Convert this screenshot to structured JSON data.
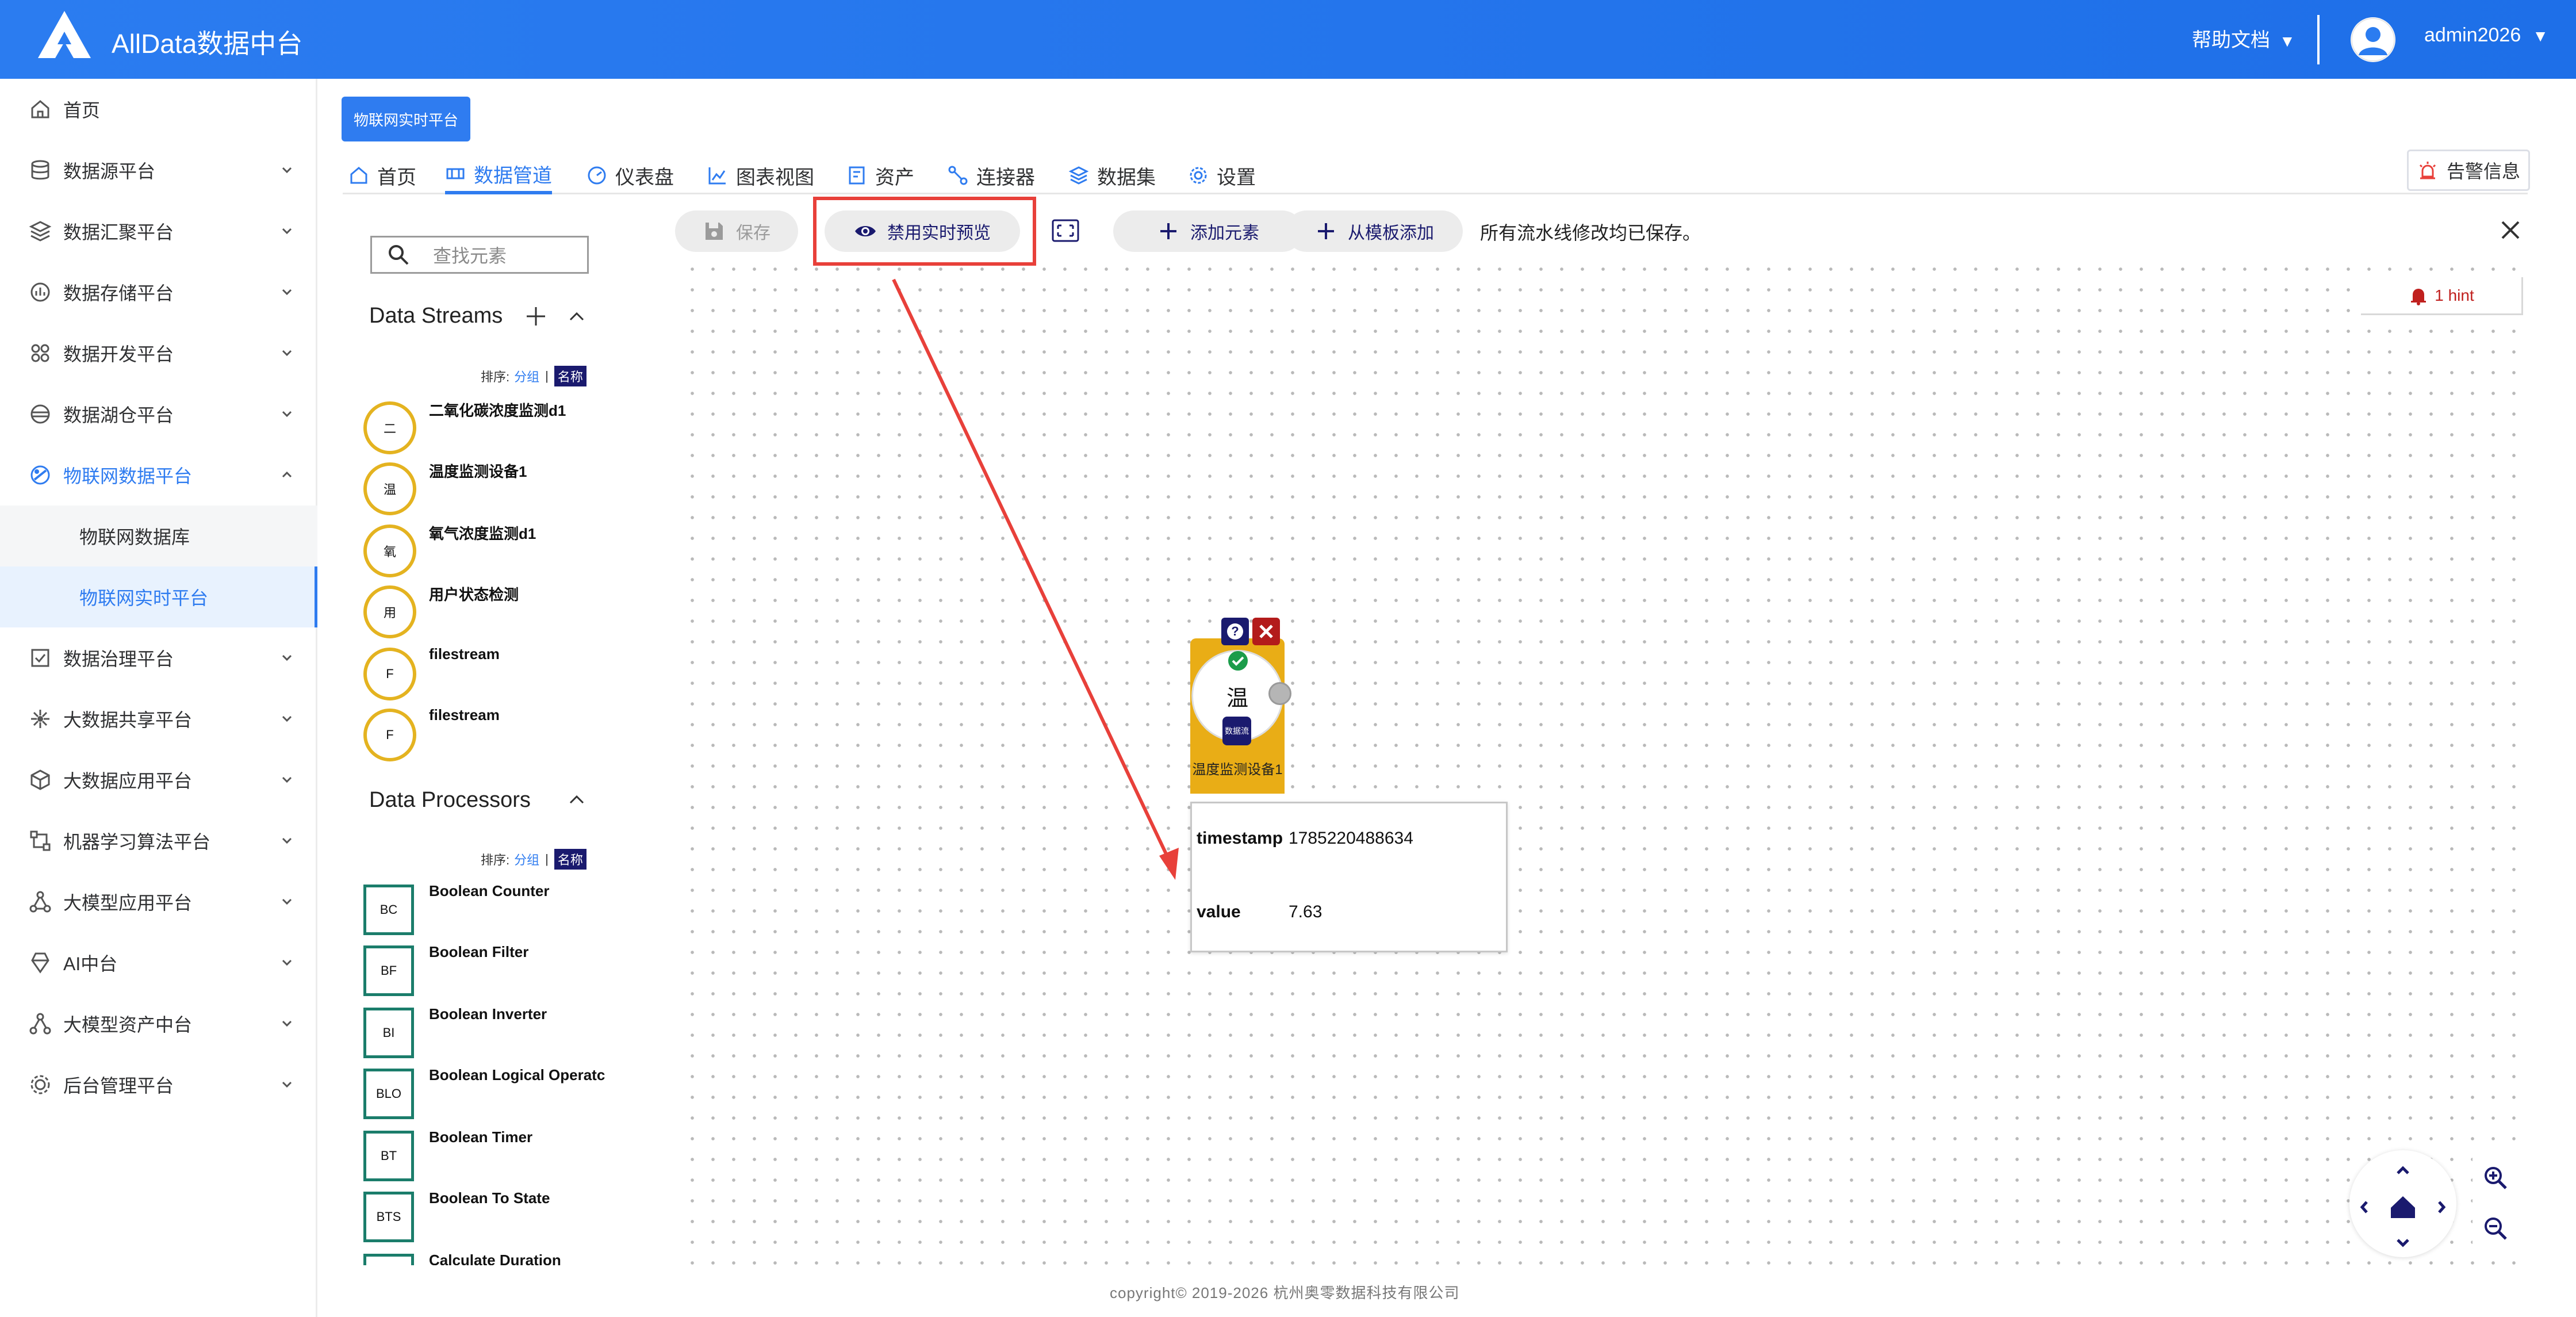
{
  "header": {
    "app_title": "AllData数据中台",
    "help_label": "帮助文档",
    "user_name": "admin2026",
    "caret": "▼"
  },
  "sidebar": {
    "items": [
      {
        "label": "首页",
        "icon": "home-icon"
      },
      {
        "label": "数据源平台",
        "icon": "database-icon"
      },
      {
        "label": "数据汇聚平台",
        "icon": "layers-icon"
      },
      {
        "label": "数据存储平台",
        "icon": "storage-icon"
      },
      {
        "label": "数据开发平台",
        "icon": "grid-icon"
      },
      {
        "label": "数据湖仓平台",
        "icon": "lake-icon"
      },
      {
        "label": "物联网数据平台",
        "icon": "iot-icon"
      },
      {
        "label": "数据治理平台",
        "icon": "governance-icon"
      },
      {
        "label": "大数据共享平台",
        "icon": "share-icon"
      },
      {
        "label": "大数据应用平台",
        "icon": "cube-icon"
      },
      {
        "label": "机器学习算法平台",
        "icon": "ml-icon"
      },
      {
        "label": "大模型应用平台",
        "icon": "model-icon"
      },
      {
        "label": "AI中台",
        "icon": "ai-icon"
      },
      {
        "label": "大模型资产中台",
        "icon": "asset-icon"
      },
      {
        "label": "后台管理平台",
        "icon": "admin-icon"
      }
    ],
    "sub_items": [
      "物联网数据库",
      "物联网实时平台"
    ]
  },
  "page_tag": "物联网实时平台",
  "tabs": [
    {
      "label": "首页",
      "icon": "home-icon"
    },
    {
      "label": "数据管道",
      "icon": "pipeline-icon"
    },
    {
      "label": "仪表盘",
      "icon": "dashboard-icon"
    },
    {
      "label": "图表视图",
      "icon": "chart-icon"
    },
    {
      "label": "资产",
      "icon": "asset-icon"
    },
    {
      "label": "连接器",
      "icon": "connector-icon"
    },
    {
      "label": "数据集",
      "icon": "dataset-icon"
    },
    {
      "label": "设置",
      "icon": "settings-icon"
    }
  ],
  "alarm_label": "告警信息",
  "palette": {
    "search_placeholder": "查找元素",
    "streams_title": "Data Streams",
    "processors_title": "Data Processors",
    "sort_label": "排序:",
    "sort_group": "分组",
    "sort_sep": "|",
    "sort_name": "名称",
    "streams": [
      {
        "abbr": "二",
        "label": "二氧化碳浓度监测d1"
      },
      {
        "abbr": "温",
        "label": "温度监测设备1"
      },
      {
        "abbr": "氧",
        "label": "氧气浓度监测d1"
      },
      {
        "abbr": "用",
        "label": "用户状态检测"
      },
      {
        "abbr": "F",
        "label": "filestream"
      },
      {
        "abbr": "F",
        "label": "filestream"
      }
    ],
    "processors": [
      {
        "abbr": "BC",
        "label": "Boolean Counter"
      },
      {
        "abbr": "BF",
        "label": "Boolean Filter"
      },
      {
        "abbr": "BI",
        "label": "Boolean Inverter"
      },
      {
        "abbr": "BLO",
        "label": "Boolean Logical Operatc"
      },
      {
        "abbr": "BT",
        "label": "Boolean Timer"
      },
      {
        "abbr": "BTS",
        "label": "Boolean To State"
      },
      {
        "abbr": "",
        "label": "Calculate Duration"
      }
    ]
  },
  "toolbar": {
    "save_label": "保存",
    "preview_label": "禁用实时预览",
    "add_element_label": "添加元素",
    "add_template_label": "从模板添加",
    "saved_message": "所有流水线修改均已保存。"
  },
  "hint_label": "1 hint",
  "node": {
    "abbr": "温",
    "label": "温度监测设备1",
    "badge": "数据流"
  },
  "preview": {
    "rows": [
      {
        "key": "timestamp",
        "value": "1785220488634"
      },
      {
        "key": "value",
        "value": "7.63"
      }
    ]
  },
  "footer": "copyright© 2019-2026 杭州奥零数据科技有限公司",
  "colors": {
    "primary": "#2f7cf0",
    "highlight": "#e8403a",
    "stream_border": "#e4b320",
    "processor_border": "#1b7d6b",
    "node_fill": "#e9ad16"
  }
}
